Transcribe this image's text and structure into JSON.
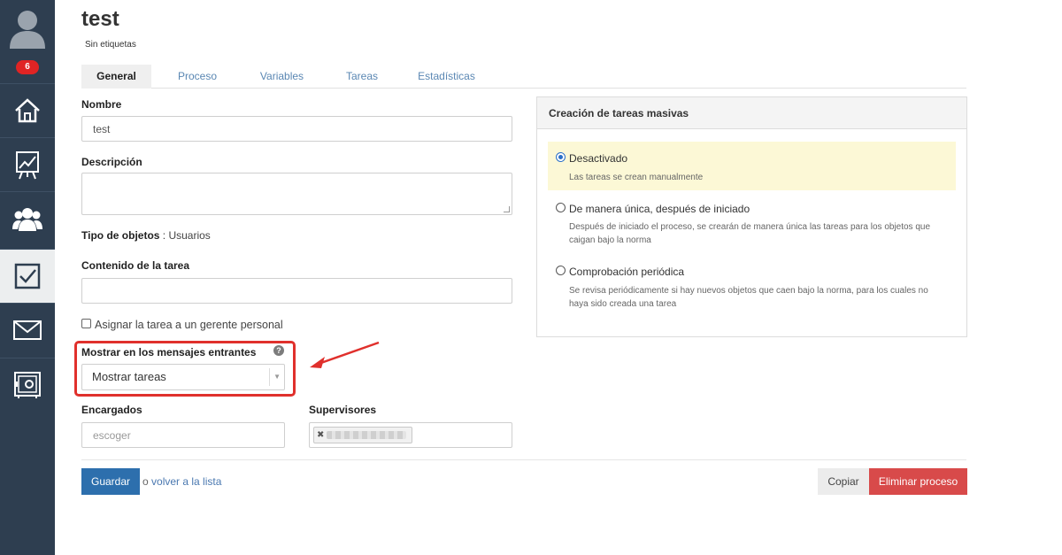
{
  "sidebar": {
    "badge": "6",
    "items": [
      {
        "icon": "home-icon"
      },
      {
        "icon": "chart-icon"
      },
      {
        "icon": "users-icon"
      },
      {
        "icon": "checkbox-icon",
        "active": true
      },
      {
        "icon": "mail-icon"
      },
      {
        "icon": "safe-icon"
      }
    ]
  },
  "header": {
    "title": "test",
    "subtitle": "Sin etiquetas"
  },
  "tabs": [
    "General",
    "Proceso",
    "Variables",
    "Tareas",
    "Estadísticas"
  ],
  "form": {
    "name_label": "Nombre",
    "name_value": "test",
    "description_label": "Descripción",
    "object_type_label": "Tipo de objetos",
    "object_type_value": " : Usuarios",
    "task_content_label": "Contenido de la tarea",
    "assign_manager_label": "Asignar la tarea a un gerente personal",
    "incoming_label": "Mostrar en los mensajes entrantes",
    "incoming_value": "Mostrar tareas",
    "assignees_label": "Encargados",
    "assignees_placeholder": "escoger",
    "supervisors_label": "Supervisores"
  },
  "actions": {
    "save": "Guardar",
    "back_prefix": "o ",
    "back_link": "volver a la lista",
    "copy": "Copiar",
    "delete": "Eliminar proceso"
  },
  "panel": {
    "title": "Creación de tareas masivas",
    "options": [
      {
        "label": "Desactivado",
        "desc": "Las tareas se crean manualmente",
        "selected": true
      },
      {
        "label": "De manera única, después de iniciado",
        "desc": "Después de iniciado el proceso, se crearán de manera única las tareas para los objetos que caigan bajo la norma",
        "selected": false
      },
      {
        "label": "Comprobación periódica",
        "desc": "Se revisa periódicamente si hay nuevos objetos que caen bajo la norma, para los cuales no haya sido creada una tarea",
        "selected": false
      }
    ]
  },
  "colors": {
    "sidebar": "#2e3e50",
    "primary": "#2d6fad",
    "danger": "#d84a4a",
    "highlight": "#e0302c",
    "selected_option": "#fcf8d6"
  }
}
